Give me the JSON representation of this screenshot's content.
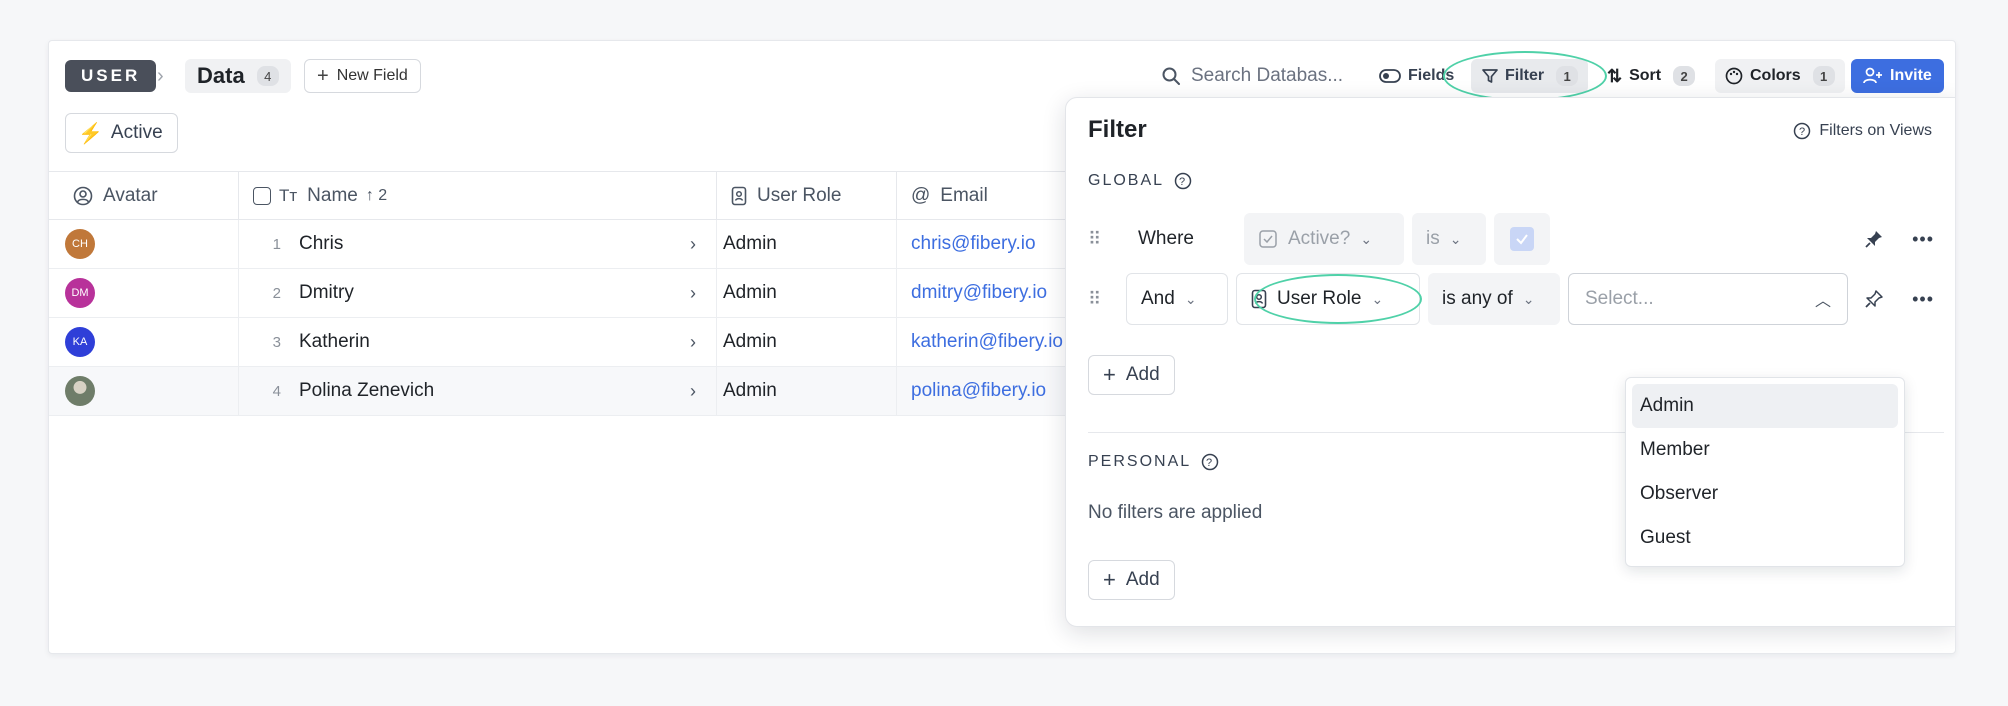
{
  "toolbar": {
    "database_badge": "USER",
    "view_name": "Data",
    "view_count": "4",
    "new_field_label": "New Field",
    "search_placeholder": "Search Databas...",
    "fields_label": "Fields",
    "filter_label": "Filter",
    "filter_count": "1",
    "sort_label": "Sort",
    "sort_count": "2",
    "colors_label": "Colors",
    "colors_count": "1",
    "invite_label": "Invite"
  },
  "active_filter_chip": "Active",
  "table": {
    "columns": [
      {
        "label": "Avatar",
        "icon": "avatar-icon"
      },
      {
        "label": "Name",
        "icon": "text-icon",
        "sort": "↑ 2"
      },
      {
        "label": "User Role",
        "icon": "badge-icon"
      },
      {
        "label": "Email",
        "icon": "at-icon"
      }
    ],
    "rows": [
      {
        "initials": "CH",
        "avatar_color": "#c0783a",
        "num": "1",
        "name": "Chris",
        "role": "Admin",
        "email": "chris@fibery.io"
      },
      {
        "initials": "DM",
        "avatar_color": "#b8329a",
        "num": "2",
        "name": "Dmitry",
        "role": "Admin",
        "email": "dmitry@fibery.io"
      },
      {
        "initials": "KA",
        "avatar_color": "#2f3fd8",
        "num": "3",
        "name": "Katherin",
        "role": "Admin",
        "email": "katherin@fibery.io"
      },
      {
        "initials": "",
        "avatar_color": "#7b8a74",
        "num": "4",
        "name": "Polina Zenevich",
        "role": "Admin",
        "email": "polina@fibery.io"
      }
    ]
  },
  "filter_panel": {
    "title": "Filter",
    "filters_on_views": "Filters on Views",
    "global_label": "GLOBAL",
    "rule1": {
      "connector": "Where",
      "field": "Active?",
      "operator": "is"
    },
    "rule2": {
      "connector": "And",
      "field": "User Role",
      "operator": "is any of",
      "value_placeholder": "Select..."
    },
    "add_label": "Add",
    "personal_label": "PERSONAL",
    "no_filters": "No filters are applied",
    "options": [
      "Admin",
      "Member",
      "Observer",
      "Guest"
    ],
    "highlighted_option": "Admin"
  },
  "colors": {
    "accent": "#3d6ee0",
    "highlight_ring": "#4fd1a8",
    "bolt": "#f0b429"
  }
}
